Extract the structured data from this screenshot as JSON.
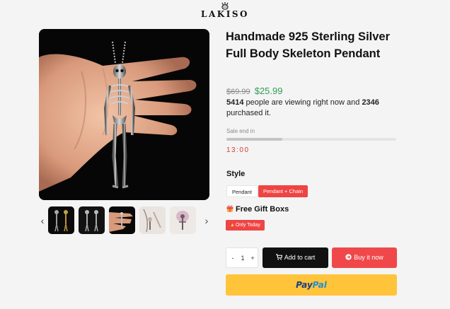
{
  "header": {
    "logo_text": "LAKISO",
    "logo_icon": "skull-crown-icon"
  },
  "gallery": {
    "main_image": "skeleton-pendant-in-hand",
    "prev_icon": "chevron-left-icon",
    "next_icon": "chevron-right-icon",
    "thumbnails": [
      "skeleton-pendant-front",
      "skeleton-pendant-pair",
      "skeleton-pendant-in-hand",
      "skeleton-pendant-on-chain",
      "skeleton-pendant-closeup"
    ]
  },
  "product": {
    "title": "Handmade 925 Sterling Silver Full Body Skeleton Pendant",
    "old_price": "$69.99",
    "price": "$25.99",
    "viewing_count": "5414",
    "viewing_text": " people are viewing right now and ",
    "purchased_count": "2346",
    "purchased_text": " purchased it."
  },
  "sale": {
    "label": "Sale end in",
    "progress_fraction": 0.33,
    "countdown": "13:00"
  },
  "style": {
    "label": "Style",
    "options": [
      "Pendant",
      "Pendant + Chain"
    ],
    "selected": "Pendant + Chain"
  },
  "gift": {
    "icon": "gift-icon",
    "label": "Free Gift Boxs",
    "badge": "Only Today"
  },
  "purchase": {
    "qty_minus": "-",
    "quantity": "1",
    "qty_plus": "+",
    "add_to_cart": "Add to cart",
    "buy_now": "Buy it now",
    "paypal_part1": "Pay",
    "paypal_part2": "Pal"
  },
  "colors": {
    "price_green": "#2f9d5b",
    "accent_red": "#ef4444",
    "paypal_yellow": "#ffc439",
    "paypal_navy": "#1c3c85",
    "paypal_blue": "#1f8fd6"
  }
}
